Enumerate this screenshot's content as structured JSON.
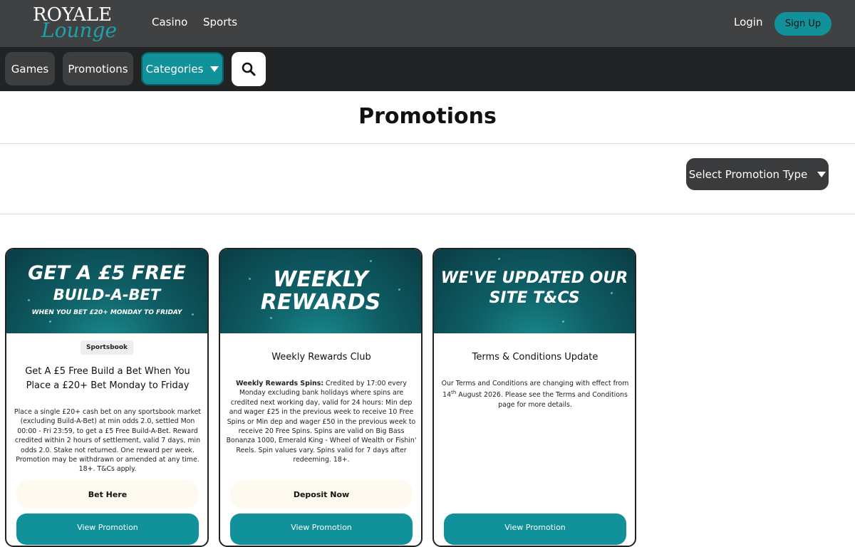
{
  "brand": {
    "line1": "ROYALE",
    "line2": "Lounge",
    "accent": "#11919a"
  },
  "topnav": {
    "casino": "Casino",
    "sports": "Sports",
    "login": "Login",
    "signup": "Sign Up"
  },
  "subnav": {
    "games": "Games",
    "promotions": "Promotions",
    "categories": "Categories",
    "search_icon": "search-icon"
  },
  "page": {
    "title": "Promotions",
    "select_type": "Select Promotion Type"
  },
  "cards": [
    {
      "banner_lines": [
        "GET A £5 FREE",
        "BUILD-A-BET",
        "WHEN YOU BET £20+ MONDAY TO FRIDAY"
      ],
      "tag": "Sportsbook",
      "title": "Get A £5 Free Build a Bet When You Place a £20+ Bet Monday to Friday",
      "body": "Place a single £20+ cash bet on any sportsbook market (excluding Build-A-Bet) at min odds 2.0, settled Mon 00:00 - Fri 23:59, to get a £5 Free Build-A-Bet. Reward credited within 2 hours of settlement, valid 7 days, min odds 2.0. Stake not returned. One reward per week. Promotion may be withdrawn or amended at any time. 18+. T&Cs apply.",
      "action": "Bet Here",
      "view": "View Promotion"
    },
    {
      "banner_lines": [
        "WEEKLY",
        "REWARDS"
      ],
      "title": "Weekly Rewards Club",
      "body_bold": "Weekly Rewards Spins:",
      "body": " Credited by 17:00 every Monday excluding bank holidays where spins are credited next working day, valid for 24 hours: Min dep and wager £25 in the previous week to receive 10 Free Spins or Min dep and wager £50 in the previous week to receive 20 Free Spins. Spins are valid on Big Bass Bonanza 1000, Emerald King - Wheel of Wealth or Fishin' Reels. Spin values vary. Spins valid for 7 days after redeeming. 18+.",
      "action": "Deposit Now",
      "view": "View Promotion"
    },
    {
      "banner_lines": [
        "WE'VE UPDATED OUR",
        "SITE T&CS"
      ],
      "title": "Terms & Conditions Update",
      "body_pre": "Our Terms and Conditions are changing with effect from 14",
      "body_sup": "th",
      "body_post": " August 2026. Please see the Terms and Conditions page for more details.",
      "view": "View Promotion"
    }
  ]
}
